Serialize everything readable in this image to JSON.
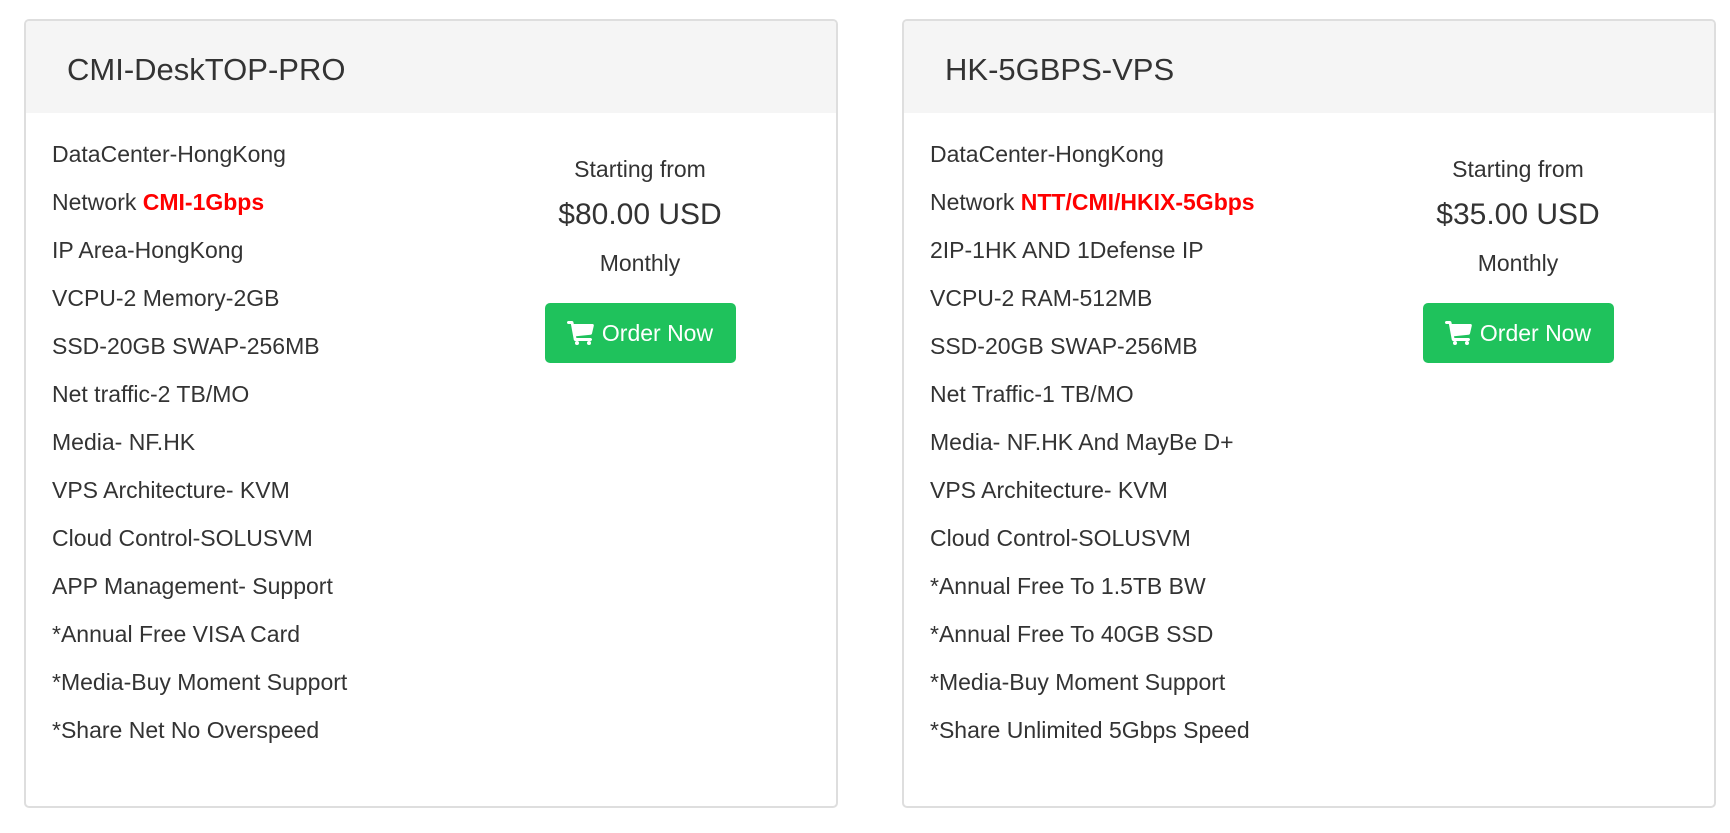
{
  "colors": {
    "accent_red": "#ff0000",
    "order_button": "#1fc25c",
    "header_bg": "#f5f5f5"
  },
  "products": [
    {
      "title": "CMI-DeskTOP-PRO",
      "features": [
        {
          "text": "DataCenter-HongKong"
        },
        {
          "prefix": "Network ",
          "highlight": "CMI-1Gbps"
        },
        {
          "text": "IP Area-HongKong"
        },
        {
          "text": "VCPU-2 Memory-2GB"
        },
        {
          "text": "SSD-20GB SWAP-256MB"
        },
        {
          "text": "Net traffic-2 TB/MO"
        },
        {
          "text": "Media- NF.HK"
        },
        {
          "text": "VPS Architecture- KVM"
        },
        {
          "text": "Cloud Control-SOLUSVM"
        },
        {
          "text": "APP Management- Support"
        },
        {
          "text": "*Annual Free VISA Card"
        },
        {
          "text": "*Media-Buy Moment Support"
        },
        {
          "text": "*Share Net No Overspeed"
        }
      ],
      "pricing": {
        "starting_label": "Starting from",
        "price": "$80.00 USD",
        "cycle": "Monthly",
        "button_label": "Order Now",
        "button_icon": "shopping-cart-icon"
      }
    },
    {
      "title": "HK-5GBPS-VPS",
      "features": [
        {
          "text": "DataCenter-HongKong"
        },
        {
          "prefix": "Network ",
          "highlight": "NTT/CMI/HKIX-5Gbps"
        },
        {
          "text": "2IP-1HK AND 1Defense IP"
        },
        {
          "text": "VCPU-2 RAM-512MB"
        },
        {
          "text": "SSD-20GB SWAP-256MB"
        },
        {
          "text": "Net Traffic-1 TB/MO"
        },
        {
          "text": "Media- NF.HK And MayBe D+"
        },
        {
          "text": "VPS Architecture- KVM"
        },
        {
          "text": "Cloud Control-SOLUSVM"
        },
        {
          "text": "*Annual Free To 1.5TB BW"
        },
        {
          "text": "*Annual Free To 40GB SSD"
        },
        {
          "text": "*Media-Buy Moment Support"
        },
        {
          "text": "*Share Unlimited 5Gbps Speed"
        }
      ],
      "pricing": {
        "starting_label": "Starting from",
        "price": "$35.00 USD",
        "cycle": "Monthly",
        "button_label": "Order Now",
        "button_icon": "shopping-cart-icon"
      }
    }
  ]
}
